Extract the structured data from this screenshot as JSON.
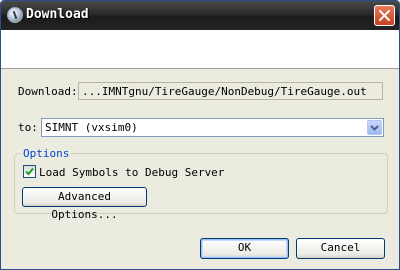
{
  "window": {
    "title": "Download",
    "icon": "download-app-icon"
  },
  "download": {
    "label": "Download:",
    "path": "...IMNTgnu/TireGauge/NonDebug/TireGauge.out"
  },
  "target": {
    "label": "to:",
    "selected": "SIMNT (vxsim0)"
  },
  "options": {
    "title": "Options",
    "load_symbols_label": "Load Symbols to Debug Server",
    "load_symbols_checked": true,
    "advanced_label": "Advanced Options..."
  },
  "footer": {
    "ok_label": "OK",
    "cancel_label": "Cancel"
  },
  "colors": {
    "title_bar": "#2a2a2a",
    "close_button": "#d65a36",
    "group_title": "#0046d5",
    "dialog_body": "#ecebdf"
  }
}
